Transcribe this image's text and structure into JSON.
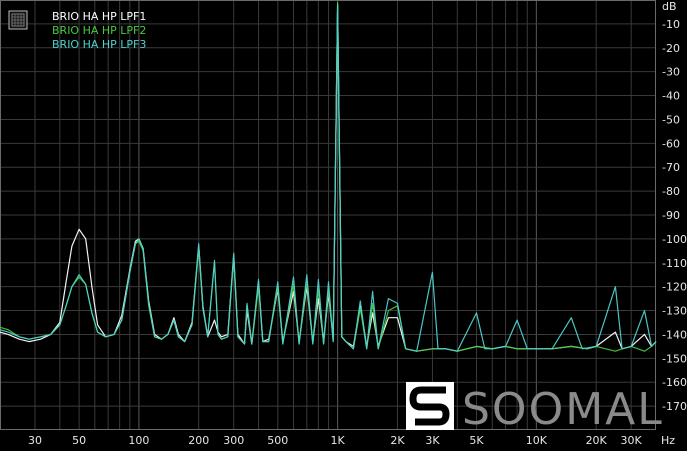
{
  "chart_data": {
    "type": "line",
    "xscale": "log",
    "xlim": [
      20,
      40000
    ],
    "ylim": [
      -180,
      0
    ],
    "grid": true,
    "legend_position": "top-left",
    "x_unit_label": "Hz",
    "x_ticks": [
      {
        "value": 30,
        "label": "30"
      },
      {
        "value": 50,
        "label": "50"
      },
      {
        "value": 100,
        "label": "100"
      },
      {
        "value": 200,
        "label": "200"
      },
      {
        "value": 300,
        "label": "300"
      },
      {
        "value": 500,
        "label": "500"
      },
      {
        "value": 1000,
        "label": "1K"
      },
      {
        "value": 2000,
        "label": "2K"
      },
      {
        "value": 3000,
        "label": "3K"
      },
      {
        "value": 5000,
        "label": "5K"
      },
      {
        "value": 10000,
        "label": "10K"
      },
      {
        "value": 20000,
        "label": "20K"
      },
      {
        "value": 30000,
        "label": "30K"
      }
    ],
    "y_ticks": [
      {
        "value": 0,
        "label": "dB"
      },
      {
        "value": -10,
        "label": "-10"
      },
      {
        "value": -20,
        "label": "-20"
      },
      {
        "value": -30,
        "label": "-30"
      },
      {
        "value": -40,
        "label": "-40"
      },
      {
        "value": -50,
        "label": "-50"
      },
      {
        "value": -60,
        "label": "-60"
      },
      {
        "value": -70,
        "label": "-70"
      },
      {
        "value": -80,
        "label": "-80"
      },
      {
        "value": -90,
        "label": "-90"
      },
      {
        "value": -100,
        "label": "-100"
      },
      {
        "value": -110,
        "label": "-110"
      },
      {
        "value": -120,
        "label": "-120"
      },
      {
        "value": -130,
        "label": "-130"
      },
      {
        "value": -140,
        "label": "-140"
      },
      {
        "value": -150,
        "label": "-150"
      },
      {
        "value": -160,
        "label": "-160"
      },
      {
        "value": -170,
        "label": "-170"
      }
    ],
    "series": [
      {
        "name": "BRIO HA HP LPF1",
        "color": "#ffffff",
        "points": [
          [
            20,
            -139
          ],
          [
            22,
            -140
          ],
          [
            25,
            -142
          ],
          [
            28,
            -143
          ],
          [
            32,
            -142
          ],
          [
            36,
            -140
          ],
          [
            40,
            -135
          ],
          [
            43,
            -118
          ],
          [
            46,
            -103
          ],
          [
            50,
            -96
          ],
          [
            54,
            -100
          ],
          [
            58,
            -120
          ],
          [
            62,
            -136
          ],
          [
            68,
            -141
          ],
          [
            75,
            -140
          ],
          [
            82,
            -132
          ],
          [
            90,
            -113
          ],
          [
            96,
            -101
          ],
          [
            100,
            -100
          ],
          [
            105,
            -104
          ],
          [
            112,
            -126
          ],
          [
            120,
            -140
          ],
          [
            130,
            -142
          ],
          [
            140,
            -140
          ],
          [
            150,
            -133
          ],
          [
            158,
            -140
          ],
          [
            170,
            -143
          ],
          [
            185,
            -135
          ],
          [
            200,
            -103
          ],
          [
            210,
            -128
          ],
          [
            222,
            -141
          ],
          [
            240,
            -134
          ],
          [
            250,
            -139
          ],
          [
            260,
            -141
          ],
          [
            280,
            -140
          ],
          [
            300,
            -107
          ],
          [
            315,
            -140
          ],
          [
            340,
            -144
          ],
          [
            350,
            -130
          ],
          [
            370,
            -144
          ],
          [
            400,
            -118
          ],
          [
            420,
            -143
          ],
          [
            450,
            -142
          ],
          [
            500,
            -121
          ],
          [
            530,
            -143
          ],
          [
            600,
            -122
          ],
          [
            640,
            -143
          ],
          [
            700,
            -120
          ],
          [
            750,
            -143
          ],
          [
            800,
            -125
          ],
          [
            850,
            -143
          ],
          [
            900,
            -123
          ],
          [
            950,
            -142
          ],
          [
            1000,
            -2
          ],
          [
            1050,
            -141
          ],
          [
            1100,
            -143
          ],
          [
            1200,
            -145
          ],
          [
            1300,
            -128
          ],
          [
            1400,
            -145
          ],
          [
            1500,
            -131
          ],
          [
            1600,
            -145
          ],
          [
            1800,
            -133
          ],
          [
            2000,
            -133
          ],
          [
            2200,
            -146
          ],
          [
            2500,
            -147
          ],
          [
            3000,
            -146
          ],
          [
            3500,
            -146
          ],
          [
            4000,
            -147
          ],
          [
            5000,
            -145
          ],
          [
            6000,
            -146
          ],
          [
            7000,
            -145
          ],
          [
            8000,
            -146
          ],
          [
            10000,
            -146
          ],
          [
            12000,
            -146
          ],
          [
            15000,
            -145
          ],
          [
            18000,
            -146
          ],
          [
            20000,
            -145
          ],
          [
            25000,
            -139
          ],
          [
            27000,
            -146
          ],
          [
            30000,
            -145
          ],
          [
            35000,
            -140
          ],
          [
            38000,
            -145
          ],
          [
            40000,
            -143
          ]
        ]
      },
      {
        "name": "BRIO HA HP LPF2",
        "color": "#47c93f",
        "points": [
          [
            20,
            -137
          ],
          [
            22,
            -138
          ],
          [
            25,
            -141
          ],
          [
            28,
            -142
          ],
          [
            32,
            -141
          ],
          [
            36,
            -140
          ],
          [
            40,
            -136
          ],
          [
            43,
            -128
          ],
          [
            46,
            -120
          ],
          [
            50,
            -116
          ],
          [
            54,
            -119
          ],
          [
            58,
            -131
          ],
          [
            62,
            -139
          ],
          [
            68,
            -141
          ],
          [
            75,
            -140
          ],
          [
            82,
            -134
          ],
          [
            90,
            -114
          ],
          [
            96,
            -102
          ],
          [
            100,
            -101
          ],
          [
            105,
            -105
          ],
          [
            112,
            -128
          ],
          [
            120,
            -141
          ],
          [
            130,
            -142
          ],
          [
            140,
            -140
          ],
          [
            150,
            -134
          ],
          [
            158,
            -141
          ],
          [
            170,
            -143
          ],
          [
            185,
            -136
          ],
          [
            200,
            -104
          ],
          [
            210,
            -129
          ],
          [
            222,
            -141
          ],
          [
            240,
            -110
          ],
          [
            250,
            -140
          ],
          [
            260,
            -142
          ],
          [
            280,
            -141
          ],
          [
            300,
            -108
          ],
          [
            315,
            -141
          ],
          [
            340,
            -144
          ],
          [
            350,
            -128
          ],
          [
            370,
            -144
          ],
          [
            400,
            -120
          ],
          [
            420,
            -143
          ],
          [
            450,
            -143
          ],
          [
            500,
            -120
          ],
          [
            530,
            -144
          ],
          [
            600,
            -119
          ],
          [
            640,
            -144
          ],
          [
            700,
            -118
          ],
          [
            750,
            -144
          ],
          [
            800,
            -121
          ],
          [
            850,
            -144
          ],
          [
            900,
            -121
          ],
          [
            950,
            -143
          ],
          [
            1000,
            -1
          ],
          [
            1050,
            -141
          ],
          [
            1100,
            -143
          ],
          [
            1200,
            -146
          ],
          [
            1300,
            -129
          ],
          [
            1400,
            -146
          ],
          [
            1500,
            -127
          ],
          [
            1600,
            -146
          ],
          [
            1800,
            -130
          ],
          [
            2000,
            -128
          ],
          [
            2200,
            -146
          ],
          [
            2500,
            -147
          ],
          [
            3000,
            -146
          ],
          [
            3500,
            -146
          ],
          [
            4000,
            -147
          ],
          [
            5000,
            -145
          ],
          [
            6000,
            -146
          ],
          [
            7000,
            -145
          ],
          [
            8000,
            -146
          ],
          [
            10000,
            -146
          ],
          [
            12000,
            -146
          ],
          [
            15000,
            -145
          ],
          [
            18000,
            -146
          ],
          [
            20000,
            -145
          ],
          [
            25000,
            -147
          ],
          [
            27000,
            -146
          ],
          [
            30000,
            -145
          ],
          [
            35000,
            -147
          ],
          [
            38000,
            -145
          ],
          [
            40000,
            -143
          ]
        ]
      },
      {
        "name": "BRIO HA HP LPF3",
        "color": "#4fd1cf",
        "points": [
          [
            20,
            -138
          ],
          [
            22,
            -139
          ],
          [
            25,
            -141
          ],
          [
            28,
            -142
          ],
          [
            32,
            -141
          ],
          [
            36,
            -140
          ],
          [
            40,
            -136
          ],
          [
            43,
            -128
          ],
          [
            46,
            -120
          ],
          [
            50,
            -115
          ],
          [
            54,
            -119
          ],
          [
            58,
            -131
          ],
          [
            62,
            -139
          ],
          [
            68,
            -141
          ],
          [
            75,
            -140
          ],
          [
            82,
            -134
          ],
          [
            90,
            -114
          ],
          [
            96,
            -102
          ],
          [
            100,
            -100
          ],
          [
            105,
            -104
          ],
          [
            112,
            -127
          ],
          [
            120,
            -141
          ],
          [
            130,
            -142
          ],
          [
            140,
            -140
          ],
          [
            150,
            -134
          ],
          [
            158,
            -141
          ],
          [
            170,
            -143
          ],
          [
            185,
            -136
          ],
          [
            200,
            -102
          ],
          [
            210,
            -129
          ],
          [
            222,
            -141
          ],
          [
            240,
            -109
          ],
          [
            250,
            -140
          ],
          [
            260,
            -142
          ],
          [
            280,
            -141
          ],
          [
            300,
            -106
          ],
          [
            315,
            -141
          ],
          [
            340,
            -144
          ],
          [
            350,
            -127
          ],
          [
            370,
            -144
          ],
          [
            400,
            -117
          ],
          [
            420,
            -143
          ],
          [
            450,
            -143
          ],
          [
            500,
            -118
          ],
          [
            530,
            -144
          ],
          [
            600,
            -116
          ],
          [
            640,
            -144
          ],
          [
            700,
            -115
          ],
          [
            750,
            -144
          ],
          [
            800,
            -117
          ],
          [
            850,
            -144
          ],
          [
            900,
            -118
          ],
          [
            950,
            -143
          ],
          [
            1000,
            -2
          ],
          [
            1050,
            -141
          ],
          [
            1100,
            -143
          ],
          [
            1200,
            -146
          ],
          [
            1300,
            -126
          ],
          [
            1400,
            -146
          ],
          [
            1500,
            -122
          ],
          [
            1600,
            -146
          ],
          [
            1800,
            -125
          ],
          [
            2000,
            -127
          ],
          [
            2200,
            -146
          ],
          [
            2500,
            -147
          ],
          [
            3000,
            -114
          ],
          [
            3200,
            -146
          ],
          [
            3500,
            -146
          ],
          [
            4000,
            -147
          ],
          [
            5000,
            -131
          ],
          [
            5500,
            -146
          ],
          [
            6000,
            -146
          ],
          [
            7000,
            -145
          ],
          [
            8000,
            -134
          ],
          [
            9000,
            -146
          ],
          [
            10000,
            -146
          ],
          [
            12000,
            -146
          ],
          [
            15000,
            -133
          ],
          [
            17000,
            -146
          ],
          [
            20000,
            -145
          ],
          [
            25000,
            -120
          ],
          [
            27000,
            -146
          ],
          [
            30000,
            -145
          ],
          [
            35000,
            -130
          ],
          [
            38000,
            -145
          ],
          [
            40000,
            -143
          ]
        ]
      }
    ]
  },
  "logo": {
    "text": "SOOMAL"
  }
}
